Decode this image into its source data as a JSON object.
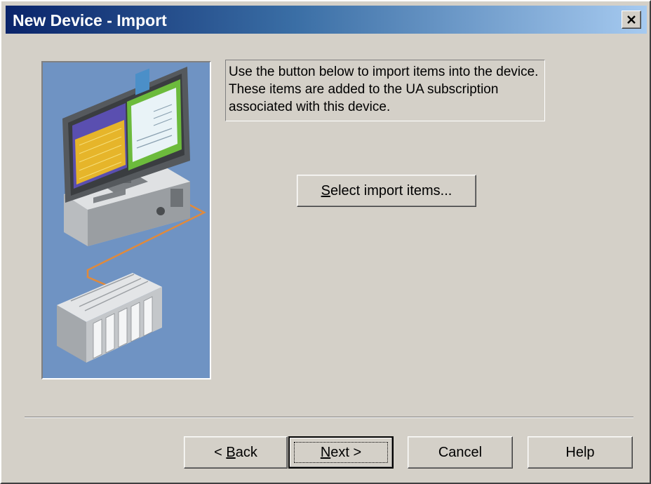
{
  "window": {
    "title": "New Device - Import",
    "close_icon": "close-x-icon"
  },
  "illustration": {
    "icon": "computer-to-device-connection-illustration",
    "colors": {
      "background": "#6f93c3",
      "cable": "#e08a3c",
      "screen_frame": "#6b6f73"
    }
  },
  "description": {
    "text": "Use the button below to import items into the device. These items are added to the UA subscription associated with this device."
  },
  "buttons": {
    "select_import": {
      "mnemonic": "S",
      "rest": "elect import items..."
    },
    "back": {
      "prefix": "< ",
      "mnemonic": "B",
      "rest": "ack"
    },
    "next": {
      "mnemonic": "N",
      "rest": "ext >"
    },
    "cancel": "Cancel",
    "help": "Help"
  }
}
